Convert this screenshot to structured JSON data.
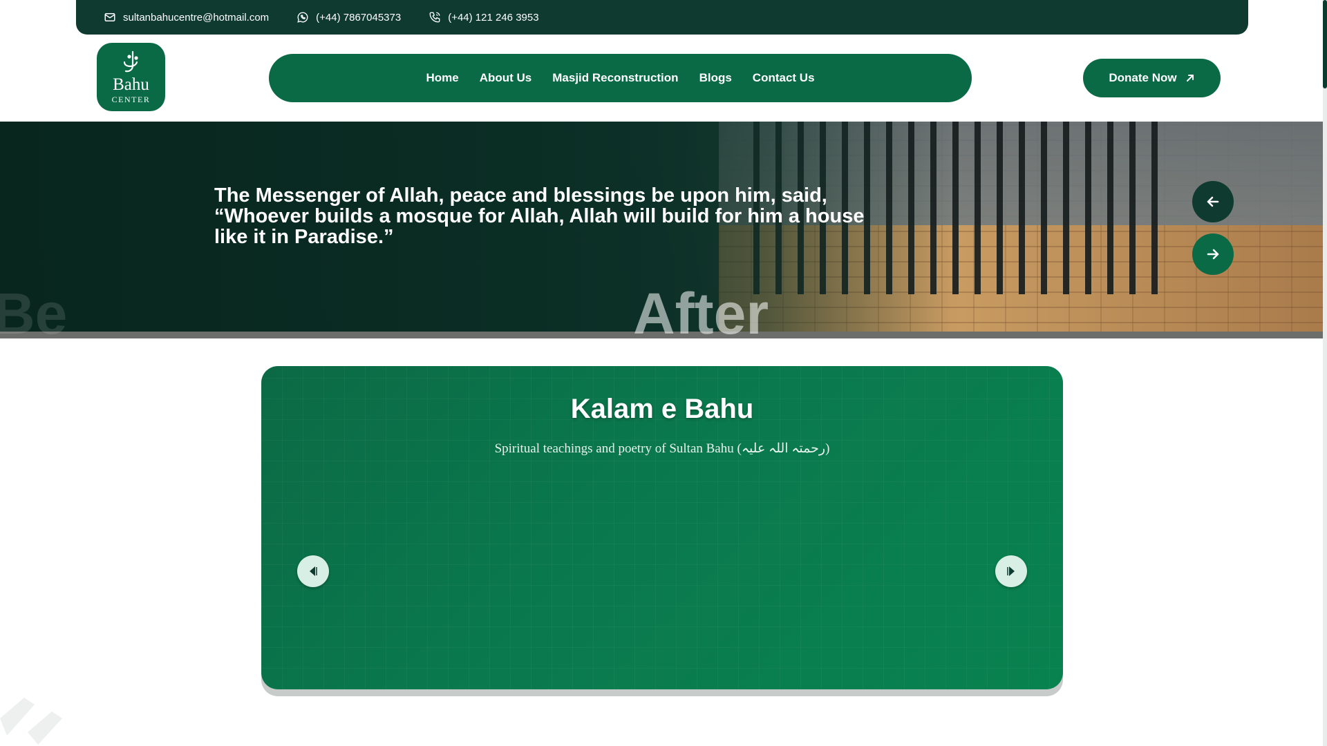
{
  "topbar": {
    "email": "sultanbahucentre@hotmail.com",
    "whatsapp": "(+44) 7867045373",
    "phone": "(+44) 121 246 3953"
  },
  "logo": {
    "name": "Bahu",
    "subtitle": "CENTER"
  },
  "nav": {
    "items": [
      {
        "label": "Home"
      },
      {
        "label": "About Us"
      },
      {
        "label": "Masjid Reconstruction"
      },
      {
        "label": "Blogs"
      },
      {
        "label": "Contact Us"
      }
    ]
  },
  "donate": {
    "label": "Donate Now"
  },
  "hero": {
    "quote": "The Messenger of Allah, peace and blessings be upon him, said, “Whoever builds a mosque for Allah, Allah will build for him a house like it in Paradise.”",
    "watermark_after": "After",
    "watermark_before": "Be"
  },
  "kalam": {
    "title": "Kalam e Bahu",
    "subtitle": "Spiritual teachings and poetry of Sultan Bahu (رحمتہ اللہ علیہ)"
  },
  "colors": {
    "primary": "#0a6a45",
    "dark": "#0f3a30",
    "white": "#ffffff"
  },
  "icons": {
    "email": "envelope-icon",
    "whatsapp": "whatsapp-icon",
    "phone": "phone-icon",
    "donate": "arrow-up-right-icon",
    "hero_prev": "arrow-left-icon",
    "hero_next": "arrow-right-icon",
    "kalam_prev": "triangle-left-icon",
    "kalam_next": "triangle-right-icon"
  }
}
